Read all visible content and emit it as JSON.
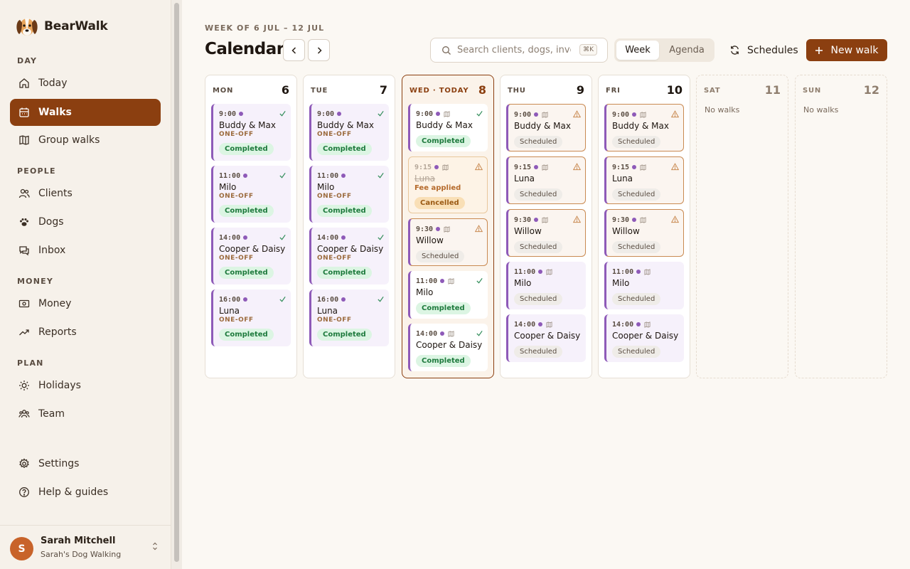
{
  "brand": {
    "name": "BearWalk"
  },
  "sidebar": {
    "sections": [
      {
        "label": "DAY",
        "items": [
          {
            "label": "Today",
            "icon": "home-icon"
          },
          {
            "label": "Walks",
            "icon": "calendar-icon",
            "active": true
          },
          {
            "label": "Group walks",
            "icon": "map-icon"
          }
        ]
      },
      {
        "label": "PEOPLE",
        "items": [
          {
            "label": "Clients",
            "icon": "users-icon"
          },
          {
            "label": "Dogs",
            "icon": "paw-icon"
          },
          {
            "label": "Inbox",
            "icon": "chat-icon"
          }
        ]
      },
      {
        "label": "MONEY",
        "items": [
          {
            "label": "Money",
            "icon": "banknote-icon"
          },
          {
            "label": "Reports",
            "icon": "trend-icon"
          }
        ]
      },
      {
        "label": "PLAN",
        "items": [
          {
            "label": "Holidays",
            "icon": "sun-icon"
          },
          {
            "label": "Team",
            "icon": "team-icon"
          }
        ]
      }
    ],
    "footer_items": [
      {
        "label": "Settings",
        "icon": "gear-icon"
      },
      {
        "label": "Help & guides",
        "icon": "help-icon"
      }
    ],
    "user": {
      "initial": "S",
      "name": "Sarah Mitchell",
      "org": "Sarah's Dog Walking"
    }
  },
  "header": {
    "week_label": "WEEK OF 6 JUL – 12 JUL",
    "title": "Calendar",
    "search_placeholder": "Search clients, dogs, invoi...",
    "search_shortcut": "⌘K",
    "view_week": "Week",
    "view_agenda": "Agenda",
    "schedules_label": "Schedules",
    "new_walk_label": "New walk"
  },
  "colors": {
    "accent": "#8b3f10",
    "walk_purple": "#8e5ab8",
    "completed_green": "#1e7a3d"
  },
  "days": [
    {
      "name": "MON",
      "num": "6",
      "walks": [
        {
          "time": "9:00",
          "name": "Buddy & Max",
          "sub": "ONE-OFF",
          "status": "Completed"
        },
        {
          "time": "11:00",
          "name": "Milo",
          "sub": "ONE-OFF",
          "status": "Completed"
        },
        {
          "time": "14:00",
          "name": "Cooper & Daisy",
          "sub": "ONE-OFF",
          "status": "Completed"
        },
        {
          "time": "16:00",
          "name": "Luna",
          "sub": "ONE-OFF",
          "status": "Completed"
        }
      ]
    },
    {
      "name": "TUE",
      "num": "7",
      "walks": [
        {
          "time": "9:00",
          "name": "Buddy & Max",
          "sub": "ONE-OFF",
          "status": "Completed"
        },
        {
          "time": "11:00",
          "name": "Milo",
          "sub": "ONE-OFF",
          "status": "Completed"
        },
        {
          "time": "14:00",
          "name": "Cooper & Daisy",
          "sub": "ONE-OFF",
          "status": "Completed"
        },
        {
          "time": "16:00",
          "name": "Luna",
          "sub": "ONE-OFF",
          "status": "Completed"
        }
      ]
    },
    {
      "name": "WED · TODAY",
      "num": "8",
      "walks": [
        {
          "time": "9:00",
          "name": "Buddy & Max",
          "status": "Completed"
        },
        {
          "time": "9:15",
          "name": "Luna",
          "sub": "Fee applied",
          "status": "Cancelled"
        },
        {
          "time": "9:30",
          "name": "Willow",
          "status": "Scheduled"
        },
        {
          "time": "11:00",
          "name": "Milo",
          "status": "Completed"
        },
        {
          "time": "14:00",
          "name": "Cooper & Daisy",
          "status": "Completed"
        }
      ]
    },
    {
      "name": "THU",
      "num": "9",
      "walks": [
        {
          "time": "9:00",
          "name": "Buddy & Max",
          "status": "Scheduled"
        },
        {
          "time": "9:15",
          "name": "Luna",
          "status": "Scheduled"
        },
        {
          "time": "9:30",
          "name": "Willow",
          "status": "Scheduled"
        },
        {
          "time": "11:00",
          "name": "Milo",
          "status": "Scheduled"
        },
        {
          "time": "14:00",
          "name": "Cooper & Daisy",
          "status": "Scheduled"
        }
      ]
    },
    {
      "name": "FRI",
      "num": "10",
      "walks": [
        {
          "time": "9:00",
          "name": "Buddy & Max",
          "status": "Scheduled"
        },
        {
          "time": "9:15",
          "name": "Luna",
          "status": "Scheduled"
        },
        {
          "time": "9:30",
          "name": "Willow",
          "status": "Scheduled"
        },
        {
          "time": "11:00",
          "name": "Milo",
          "status": "Scheduled"
        },
        {
          "time": "14:00",
          "name": "Cooper & Daisy",
          "status": "Scheduled"
        }
      ]
    },
    {
      "name": "SAT",
      "num": "11",
      "empty_text": "No walks"
    },
    {
      "name": "SUN",
      "num": "12",
      "empty_text": "No walks"
    }
  ]
}
